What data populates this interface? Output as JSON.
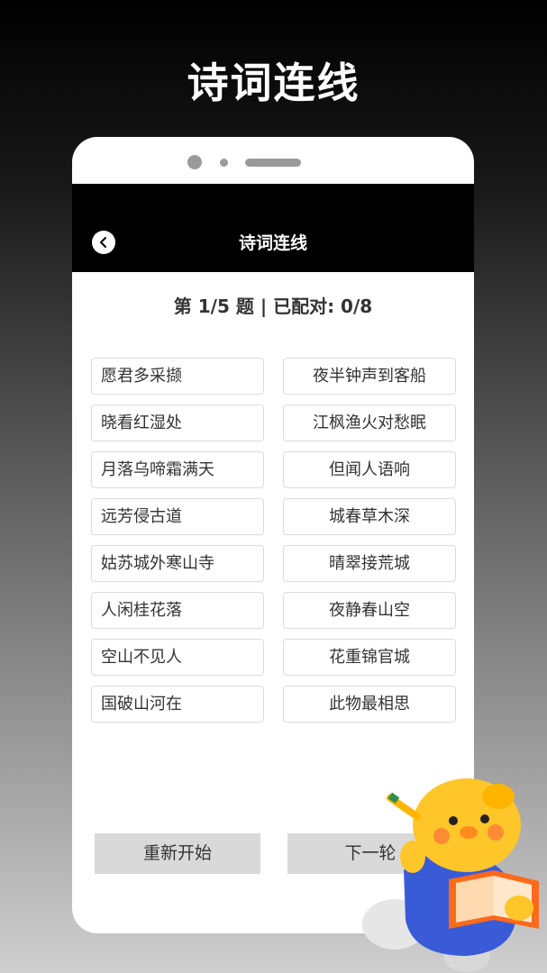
{
  "heading": "诗词连线",
  "app_bar": {
    "title": "诗词连线",
    "back_icon": "chevron-left-icon"
  },
  "status": "第 1/5 题 | 已配对: 0/8",
  "left_items": [
    "愿君多采撷",
    "晓看红湿处",
    "月落乌啼霜满天",
    "远芳侵古道",
    "姑苏城外寒山寺",
    "人闲桂花落",
    "空山不见人",
    "国破山河在"
  ],
  "right_items": [
    "夜半钟声到客船",
    "江枫渔火对愁眠",
    "但闻人语响",
    "城春草木深",
    "晴翠接荒城",
    "夜静春山空",
    "花重锦官城",
    "此物最相思"
  ],
  "buttons": {
    "restart": "重新开始",
    "next": "下一轮"
  },
  "colors": {
    "accent_black": "#000000",
    "button_gray": "#d9d9d9",
    "mascot_yellow": "#ffc62a",
    "mascot_blue": "#3a5bd8"
  }
}
